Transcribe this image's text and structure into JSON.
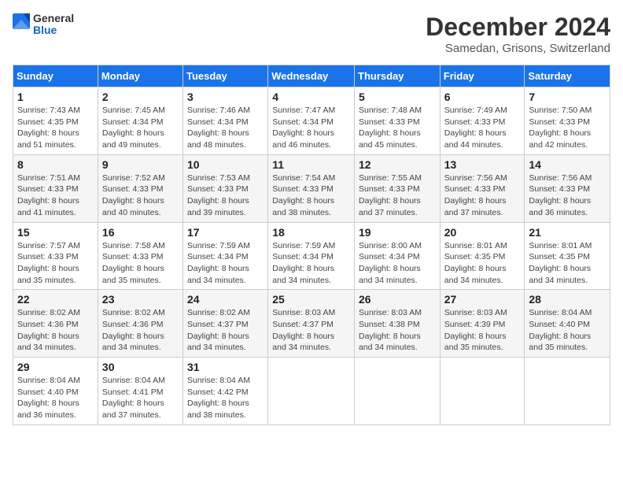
{
  "logo": {
    "general": "General",
    "blue": "Blue"
  },
  "title": "December 2024",
  "location": "Samedan, Grisons, Switzerland",
  "days_of_week": [
    "Sunday",
    "Monday",
    "Tuesday",
    "Wednesday",
    "Thursday",
    "Friday",
    "Saturday"
  ],
  "weeks": [
    [
      {
        "day": "1",
        "sunrise": "7:43 AM",
        "sunset": "4:35 PM",
        "daylight": "8 hours and 51 minutes."
      },
      {
        "day": "2",
        "sunrise": "7:45 AM",
        "sunset": "4:34 PM",
        "daylight": "8 hours and 49 minutes."
      },
      {
        "day": "3",
        "sunrise": "7:46 AM",
        "sunset": "4:34 PM",
        "daylight": "8 hours and 48 minutes."
      },
      {
        "day": "4",
        "sunrise": "7:47 AM",
        "sunset": "4:34 PM",
        "daylight": "8 hours and 46 minutes."
      },
      {
        "day": "5",
        "sunrise": "7:48 AM",
        "sunset": "4:33 PM",
        "daylight": "8 hours and 45 minutes."
      },
      {
        "day": "6",
        "sunrise": "7:49 AM",
        "sunset": "4:33 PM",
        "daylight": "8 hours and 44 minutes."
      },
      {
        "day": "7",
        "sunrise": "7:50 AM",
        "sunset": "4:33 PM",
        "daylight": "8 hours and 42 minutes."
      }
    ],
    [
      {
        "day": "8",
        "sunrise": "7:51 AM",
        "sunset": "4:33 PM",
        "daylight": "8 hours and 41 minutes."
      },
      {
        "day": "9",
        "sunrise": "7:52 AM",
        "sunset": "4:33 PM",
        "daylight": "8 hours and 40 minutes."
      },
      {
        "day": "10",
        "sunrise": "7:53 AM",
        "sunset": "4:33 PM",
        "daylight": "8 hours and 39 minutes."
      },
      {
        "day": "11",
        "sunrise": "7:54 AM",
        "sunset": "4:33 PM",
        "daylight": "8 hours and 38 minutes."
      },
      {
        "day": "12",
        "sunrise": "7:55 AM",
        "sunset": "4:33 PM",
        "daylight": "8 hours and 37 minutes."
      },
      {
        "day": "13",
        "sunrise": "7:56 AM",
        "sunset": "4:33 PM",
        "daylight": "8 hours and 37 minutes."
      },
      {
        "day": "14",
        "sunrise": "7:56 AM",
        "sunset": "4:33 PM",
        "daylight": "8 hours and 36 minutes."
      }
    ],
    [
      {
        "day": "15",
        "sunrise": "7:57 AM",
        "sunset": "4:33 PM",
        "daylight": "8 hours and 35 minutes."
      },
      {
        "day": "16",
        "sunrise": "7:58 AM",
        "sunset": "4:33 PM",
        "daylight": "8 hours and 35 minutes."
      },
      {
        "day": "17",
        "sunrise": "7:59 AM",
        "sunset": "4:34 PM",
        "daylight": "8 hours and 34 minutes."
      },
      {
        "day": "18",
        "sunrise": "7:59 AM",
        "sunset": "4:34 PM",
        "daylight": "8 hours and 34 minutes."
      },
      {
        "day": "19",
        "sunrise": "8:00 AM",
        "sunset": "4:34 PM",
        "daylight": "8 hours and 34 minutes."
      },
      {
        "day": "20",
        "sunrise": "8:01 AM",
        "sunset": "4:35 PM",
        "daylight": "8 hours and 34 minutes."
      },
      {
        "day": "21",
        "sunrise": "8:01 AM",
        "sunset": "4:35 PM",
        "daylight": "8 hours and 34 minutes."
      }
    ],
    [
      {
        "day": "22",
        "sunrise": "8:02 AM",
        "sunset": "4:36 PM",
        "daylight": "8 hours and 34 minutes."
      },
      {
        "day": "23",
        "sunrise": "8:02 AM",
        "sunset": "4:36 PM",
        "daylight": "8 hours and 34 minutes."
      },
      {
        "day": "24",
        "sunrise": "8:02 AM",
        "sunset": "4:37 PM",
        "daylight": "8 hours and 34 minutes."
      },
      {
        "day": "25",
        "sunrise": "8:03 AM",
        "sunset": "4:37 PM",
        "daylight": "8 hours and 34 minutes."
      },
      {
        "day": "26",
        "sunrise": "8:03 AM",
        "sunset": "4:38 PM",
        "daylight": "8 hours and 34 minutes."
      },
      {
        "day": "27",
        "sunrise": "8:03 AM",
        "sunset": "4:39 PM",
        "daylight": "8 hours and 35 minutes."
      },
      {
        "day": "28",
        "sunrise": "8:04 AM",
        "sunset": "4:40 PM",
        "daylight": "8 hours and 35 minutes."
      }
    ],
    [
      {
        "day": "29",
        "sunrise": "8:04 AM",
        "sunset": "4:40 PM",
        "daylight": "8 hours and 36 minutes."
      },
      {
        "day": "30",
        "sunrise": "8:04 AM",
        "sunset": "4:41 PM",
        "daylight": "8 hours and 37 minutes."
      },
      {
        "day": "31",
        "sunrise": "8:04 AM",
        "sunset": "4:42 PM",
        "daylight": "8 hours and 38 minutes."
      },
      null,
      null,
      null,
      null
    ]
  ],
  "labels": {
    "sunrise": "Sunrise:",
    "sunset": "Sunset:",
    "daylight": "Daylight:"
  }
}
